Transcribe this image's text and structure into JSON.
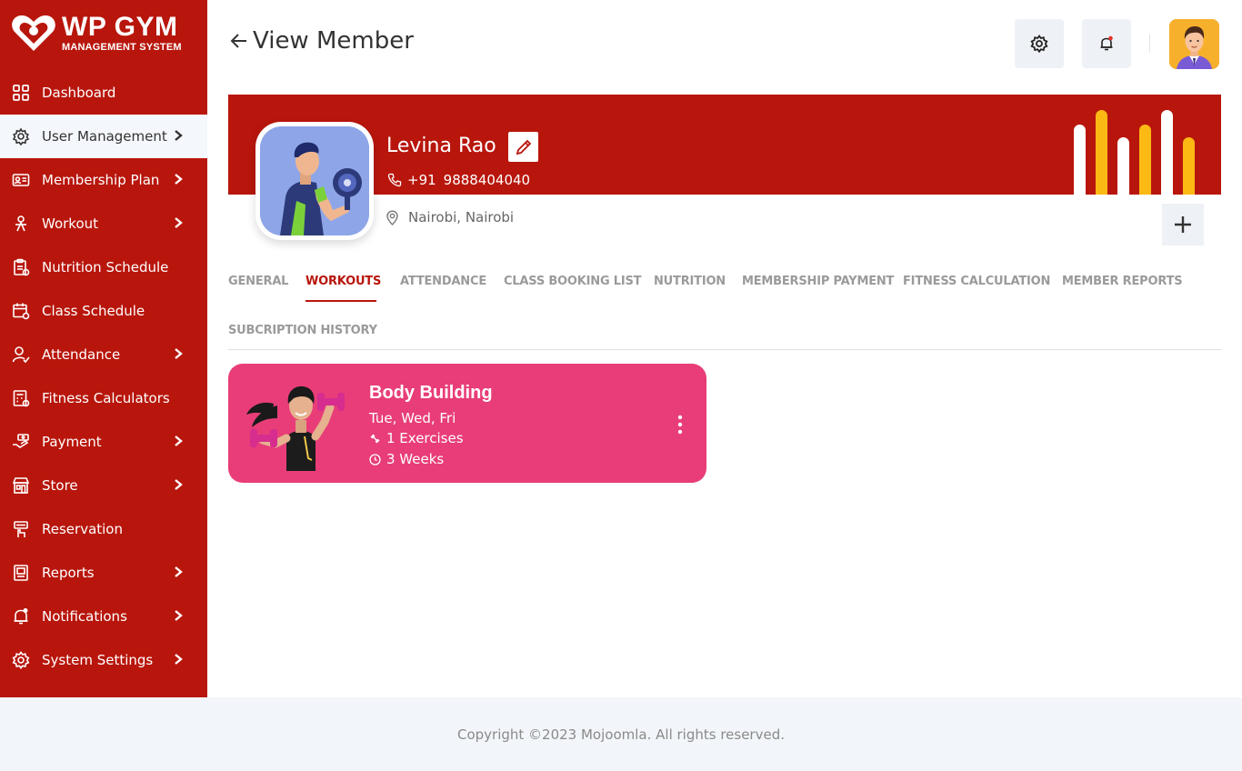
{
  "brand": {
    "title": "WP GYM",
    "subtitle": "MANAGEMENT SYSTEM"
  },
  "sidebar": {
    "items": [
      {
        "label": "Dashboard",
        "icon": "dashboard-icon",
        "chevron": false,
        "active": false
      },
      {
        "label": "User Management",
        "icon": "users-gear-icon",
        "chevron": true,
        "active": true
      },
      {
        "label": "Membership Plan",
        "icon": "membership-card-icon",
        "chevron": true,
        "active": false
      },
      {
        "label": "Workout",
        "icon": "workout-icon",
        "chevron": true,
        "active": false
      },
      {
        "label": "Nutrition Schedule",
        "icon": "clipboard-icon",
        "chevron": false,
        "active": false
      },
      {
        "label": "Class Schedule",
        "icon": "calendar-icon",
        "chevron": false,
        "active": false
      },
      {
        "label": "Attendance",
        "icon": "attendance-icon",
        "chevron": true,
        "active": false
      },
      {
        "label": "Fitness Calculators",
        "icon": "calculator-icon",
        "chevron": false,
        "active": false
      },
      {
        "label": "Payment",
        "icon": "payment-icon",
        "chevron": true,
        "active": false
      },
      {
        "label": "Store",
        "icon": "store-icon",
        "chevron": true,
        "active": false
      },
      {
        "label": "Reservation",
        "icon": "reservation-icon",
        "chevron": false,
        "active": false
      },
      {
        "label": "Reports",
        "icon": "reports-icon",
        "chevron": true,
        "active": false
      },
      {
        "label": "Notifications",
        "icon": "bell-icon",
        "chevron": true,
        "active": false
      },
      {
        "label": "System Settings",
        "icon": "gear-icon",
        "chevron": true,
        "active": false
      }
    ]
  },
  "header": {
    "title": "View Member"
  },
  "member": {
    "name": "Levina Rao",
    "phone_code": "+91",
    "phone": "9888404040",
    "location": "Nairobi, Nairobi"
  },
  "tabs": [
    {
      "label": "GENERAL",
      "active": false
    },
    {
      "label": "WORKOUTS",
      "active": true
    },
    {
      "label": "ATTENDANCE",
      "active": false
    },
    {
      "label": "CLASS BOOKING LIST",
      "active": false
    },
    {
      "label": "NUTRITION",
      "active": false
    },
    {
      "label": "MEMBERSHIP PAYMENT",
      "active": false
    },
    {
      "label": "FITNESS CALCULATION",
      "active": false
    },
    {
      "label": "MEMBER REPORTS",
      "active": false
    },
    {
      "label": "SUBCRIPTION HISTORY",
      "active": false
    }
  ],
  "workout_card": {
    "title": "Body Building",
    "days": "Tue, Wed, Fri",
    "exercises": "1 Exercises",
    "duration": "3 Weeks"
  },
  "footer": {
    "text": "Copyright ©2023 Mojoomla. All rights reserved."
  },
  "colors": {
    "primary": "#b8160c",
    "accent_yellow": "#fdb913",
    "card_pink": "#e83d78",
    "footer_bg": "#f2f5f9"
  }
}
